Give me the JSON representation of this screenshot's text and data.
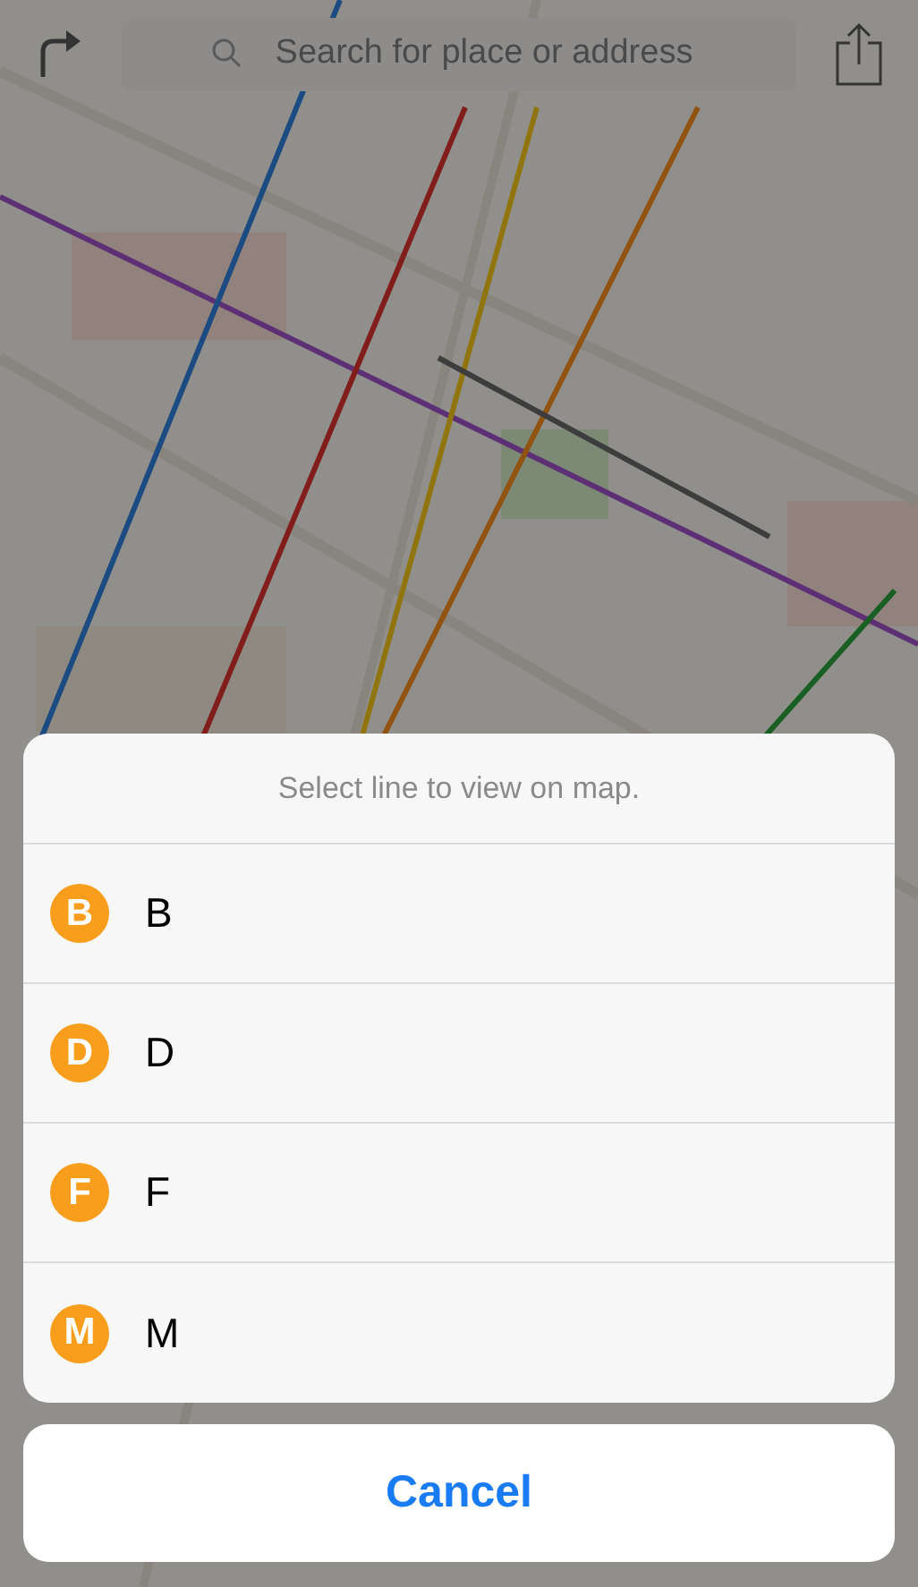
{
  "top_bar": {
    "search": {
      "placeholder": "Search for place or address"
    }
  },
  "action_sheet": {
    "title": "Select line to view on map.",
    "items": [
      {
        "badge": "B",
        "label": "B",
        "color": "#f99d1c"
      },
      {
        "badge": "D",
        "label": "D",
        "color": "#f99d1c"
      },
      {
        "badge": "F",
        "label": "F",
        "color": "#f99d1c"
      },
      {
        "badge": "M",
        "label": "M",
        "color": "#f99d1c"
      }
    ],
    "cancel": "Cancel"
  }
}
